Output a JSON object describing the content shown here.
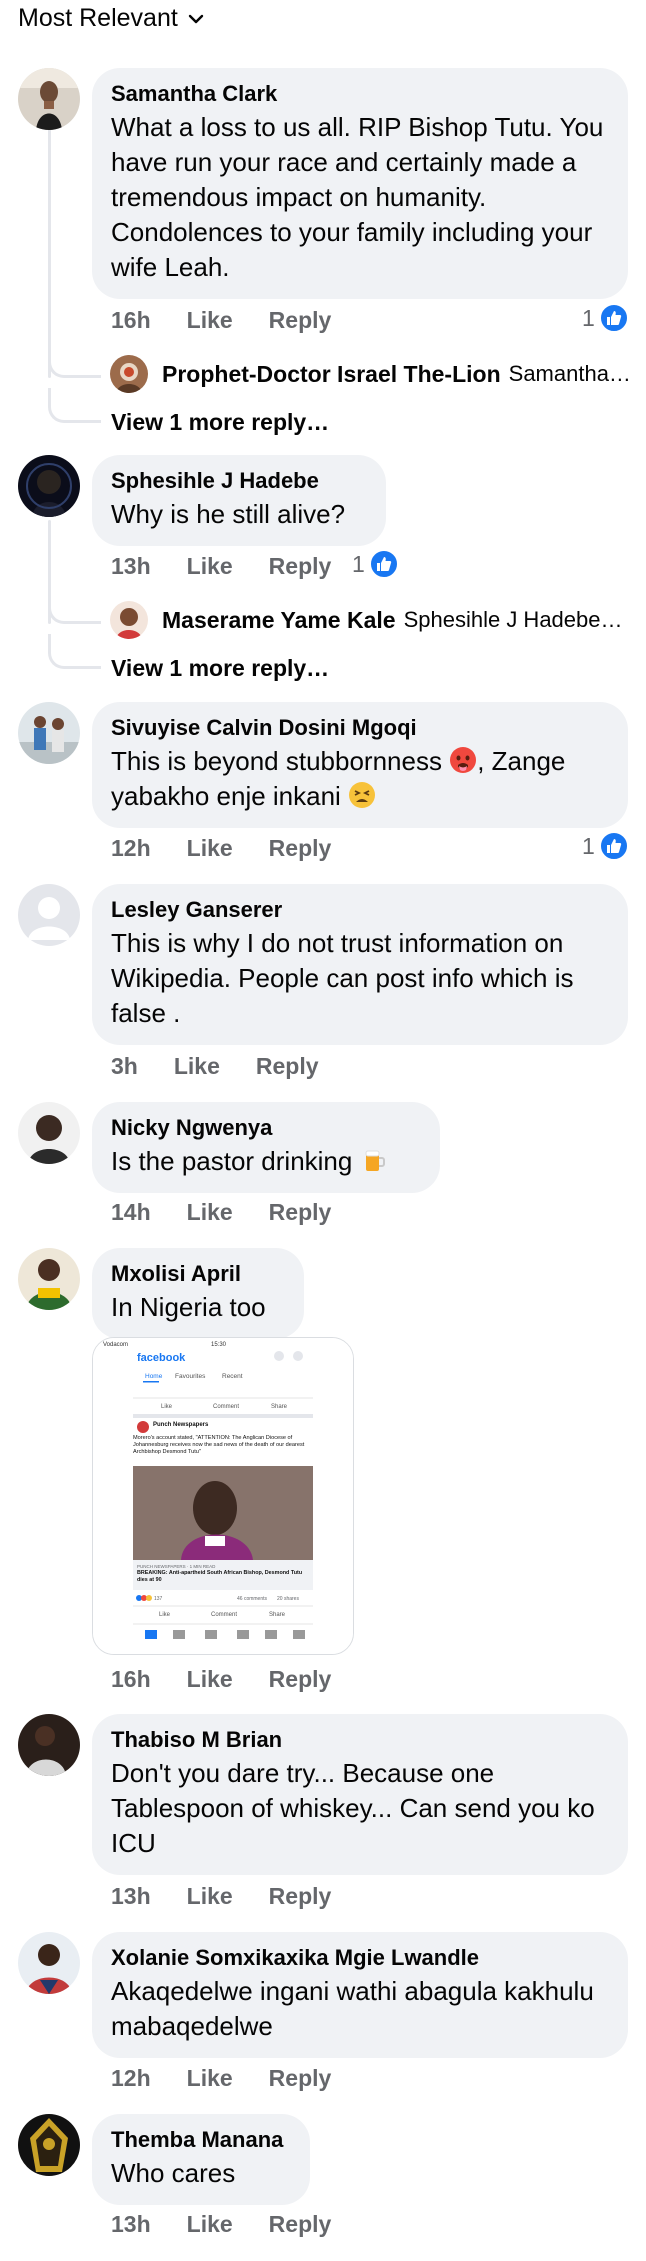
{
  "sort_label": "Most Relevant",
  "comments": [
    {
      "name": "Samantha Clark",
      "text": "What a loss to us all. RIP Bishop Tutu. You have run your race and certainly made a tremendous impact on humanity. Condolences to your family including your wife Leah.",
      "time": "16h",
      "like": "Like",
      "reply": "Reply",
      "reactions": "1",
      "reply_preview": {
        "name": "Prophet-Doctor Israel The-Lion",
        "text": "Samantha…"
      },
      "view_more": "View 1 more reply…"
    },
    {
      "name": "Sphesihle J Hadebe",
      "text": "Why is he still alive?",
      "time": "13h",
      "like": "Like",
      "reply": "Reply",
      "reactions": "1",
      "reply_preview": {
        "name": "Maserame Yame Kale",
        "text": "Sphesihle J Hadebe…"
      },
      "view_more": "View 1 more reply…"
    },
    {
      "name": "Sivuyise Calvin Dosini Mgoqi",
      "text_a": "This is beyond stubbornness",
      "text_b": ", Zange",
      "text_c": "yabakho enje inkani",
      "time": "12h",
      "like": "Like",
      "reply": "Reply",
      "reactions": "1"
    },
    {
      "name": "Lesley Ganserer",
      "text": "This is why I do not trust information on Wikipedia. People can post info which is false .",
      "time": "3h",
      "like": "Like",
      "reply": "Reply"
    },
    {
      "name": "Nicky Ngwenya",
      "text": "Is the pastor drinking",
      "time": "14h",
      "like": "Like",
      "reply": "Reply"
    },
    {
      "name": "Mxolisi April",
      "text": "In Nigeria too",
      "time": "16h",
      "like": "Like",
      "reply": "Reply",
      "attachment": {
        "carrier": "Vodacom",
        "clock": "15:30",
        "app": "facebook",
        "tabs": [
          "Home",
          "Favourites",
          "Recent"
        ],
        "like": "Like",
        "comment": "Comment",
        "share": "Share",
        "page": "Punch Newspapers",
        "post": "Morero's account stated, \"ATTENTION: The Anglican Diocese of Johannesburg receives now the sad news of the death of our dearest Archbishop Desmond Tutu\"",
        "source": "PUNCH NEWSPAPERS · 1 MIN READ",
        "headline": "BREAKING: Anti-apartheid South African Bishop, Desmond Tutu dies at 90",
        "reacts": "137",
        "comments_count": "46 comments",
        "shares": "20 shares"
      }
    },
    {
      "name": "Thabiso M Brian",
      "text": "Don't you dare try... Because one Tablespoon of whiskey... Can send you ko ICU",
      "time": "13h",
      "like": "Like",
      "reply": "Reply"
    },
    {
      "name": "Xolanie Somxikaxika Mgie Lwandle",
      "text": "Akaqedelwe ingani wathi abagula kakhulu mabaqedelwe",
      "time": "12h",
      "like": "Like",
      "reply": "Reply"
    },
    {
      "name": "Themba Manana",
      "text": "Who cares",
      "time": "13h",
      "like": "Like",
      "reply": "Reply"
    }
  ],
  "colors": {
    "bubble": "#f0f2f5",
    "secondary_text": "#65676b",
    "like_blue": "#1877f2"
  }
}
